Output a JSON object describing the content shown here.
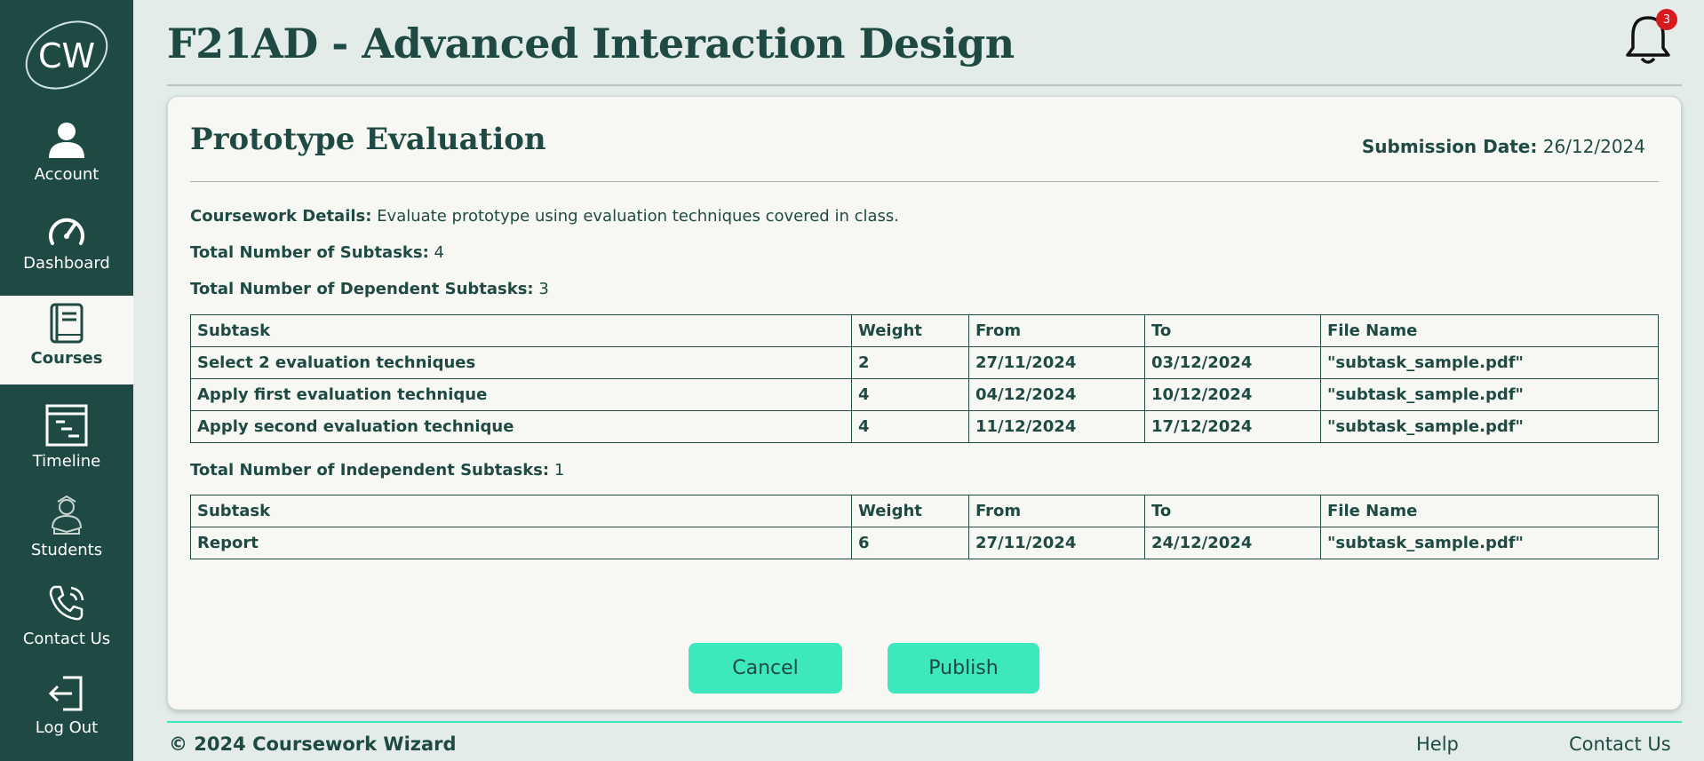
{
  "brand": {
    "logo_text": "CW"
  },
  "sidebar": {
    "items": [
      {
        "label": "Account",
        "icon": "user-icon"
      },
      {
        "label": "Dashboard",
        "icon": "speedometer-icon"
      },
      {
        "label": "Courses",
        "icon": "book-icon",
        "active": true
      },
      {
        "label": "Timeline",
        "icon": "timeline-icon"
      },
      {
        "label": "Students",
        "icon": "student-icon"
      },
      {
        "label": "Contact Us",
        "icon": "phone-icon"
      },
      {
        "label": "Log Out",
        "icon": "logout-icon"
      }
    ]
  },
  "header": {
    "title": "F21AD - Advanced Interaction Design",
    "notifications_count": "3"
  },
  "coursework": {
    "title": "Prototype Evaluation",
    "submission_label": "Submission Date:",
    "submission_date": "26/12/2024",
    "details_label": "Coursework Details:",
    "details_value": "Evaluate prototype using evaluation techniques covered in class.",
    "subtasks_label": "Total Number of Subtasks:",
    "subtasks_value": "4",
    "dependent_label": "Total Number of Dependent Subtasks:",
    "dependent_value": "3",
    "independent_label": "Total Number of Independent Subtasks:",
    "independent_value": "1"
  },
  "table_headers": [
    "Subtask",
    "Weight",
    "From",
    "To",
    "File Name"
  ],
  "dependent_subtasks": [
    [
      "Select 2 evaluation techniques",
      "2",
      "27/11/2024",
      "03/12/2024",
      "\"subtask_sample.pdf\""
    ],
    [
      "Apply first evaluation technique",
      "4",
      "04/12/2024",
      "10/12/2024",
      "\"subtask_sample.pdf\""
    ],
    [
      "Apply second evaluation technique",
      "4",
      "11/12/2024",
      "17/12/2024",
      "\"subtask_sample.pdf\""
    ]
  ],
  "independent_subtasks": [
    [
      "Report",
      "6",
      "27/11/2024",
      "24/12/2024",
      "\"subtask_sample.pdf\""
    ]
  ],
  "actions": {
    "cancel_label": "Cancel",
    "publish_label": "Publish"
  },
  "footer": {
    "copyright": "© 2024 Coursework Wizard",
    "help_label": "Help",
    "contact_label": "Contact Us"
  },
  "colors": {
    "primary": "#1f4a44",
    "accent": "#3de8bd",
    "card_bg": "#f7f8f3",
    "page_bg": "#e3ece8",
    "badge": "#d71920"
  }
}
